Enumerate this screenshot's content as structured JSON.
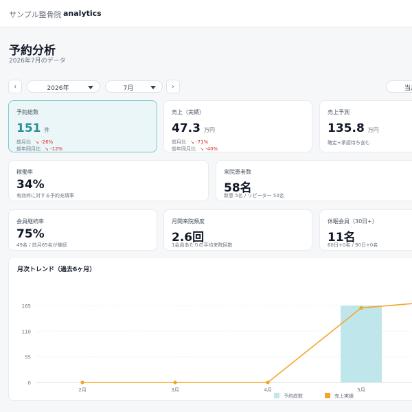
{
  "breadcrumb": {
    "home": "サンプル整骨院",
    "separator": "›",
    "current": "analytics"
  },
  "header": {
    "title": "予約分析",
    "subtitle": "2026年7月のデータ"
  },
  "controls": {
    "prev_label": "‹",
    "next_label": "›",
    "year_value": "2026年",
    "month_value": "7月",
    "this_month_label": "当月"
  },
  "kpi": {
    "bookings": {
      "label": "予約総数",
      "value": "151",
      "unit": "件",
      "mom_label": "前月比",
      "mom_value": "↘ -26%",
      "yoy_label": "前年同月比",
      "yoy_value": "↘ -12%"
    },
    "sales": {
      "label": "売上（実績）",
      "value": "47.3",
      "unit": "万円",
      "mom_label": "前月比",
      "mom_value": "↘ -71%",
      "yoy_label": "前年同月比",
      "yoy_value": "↘ -40%"
    },
    "forecast": {
      "label": "売上予測",
      "value": "135.8",
      "unit": "万円",
      "note": "確定+承認待ち含む"
    },
    "utilization": {
      "label": "稼働率",
      "value": "34%",
      "note": "有効枠に対する予約充填率"
    },
    "patients": {
      "label": "来院患者数",
      "value": "58名",
      "note": "新患 5名 / リピーター 53名"
    },
    "retention": {
      "label": "会員継続率",
      "value": "75%",
      "note": "49名 / 前月65名が継続"
    },
    "frequency": {
      "label": "月間来院頻度",
      "value": "2.6回",
      "note": "1会員あたりの平均来院回数"
    },
    "dormant": {
      "label": "休眠会員（30日+）",
      "value": "11名",
      "note": "60日+0名 / 90日+0名"
    }
  },
  "chart_data": {
    "type": "bar",
    "title": "月次トレンド（過去6ヶ月）",
    "categories": [
      "2月",
      "3月",
      "4月",
      "5月"
    ],
    "ylim": [
      0,
      165
    ],
    "yticks": [
      0,
      55,
      110,
      165
    ],
    "grid": true,
    "legend_position": "bottom",
    "series": [
      {
        "name": "予約総数",
        "type": "bar",
        "color": "#bfe6ea",
        "values": [
          0,
          0,
          0,
          165
        ]
      },
      {
        "name": "売上実績",
        "type": "line",
        "color": "#f5a524",
        "values": [
          0,
          0,
          0,
          160
        ]
      }
    ]
  }
}
